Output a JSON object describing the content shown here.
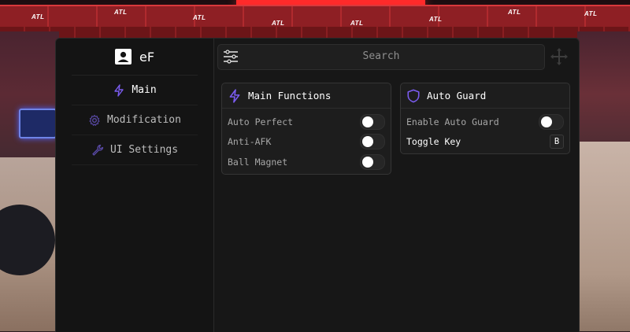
{
  "backdrop": {
    "signs": [
      "ATL",
      "ATL",
      "ATL",
      "ATL",
      "ATL",
      "ATL",
      "ATL",
      "ATL"
    ]
  },
  "sidebar": {
    "profile_name": "eF",
    "items": [
      {
        "label": "Main",
        "icon": "lightning-icon",
        "active": true
      },
      {
        "label": "Modification",
        "icon": "gear-icon",
        "active": false
      },
      {
        "label": "UI Settings",
        "icon": "wrench-icon",
        "active": false
      }
    ]
  },
  "topbar": {
    "search_label": "Search"
  },
  "cards": {
    "main_functions": {
      "title": "Main Functions",
      "icon": "lightning-icon",
      "rows": [
        {
          "label": "Auto Perfect",
          "on": false
        },
        {
          "label": "Anti-AFK",
          "on": false
        },
        {
          "label": "Ball Magnet",
          "on": false
        }
      ]
    },
    "auto_guard": {
      "title": "Auto Guard",
      "icon": "shield-icon",
      "enable_label": "Enable Auto Guard",
      "enable_on": false,
      "toggle_key_label": "Toggle Key",
      "toggle_key_value": "B"
    }
  },
  "colors": {
    "accent": "#7b5cf0",
    "panel": "#171717",
    "card": "#1d1d1d"
  }
}
